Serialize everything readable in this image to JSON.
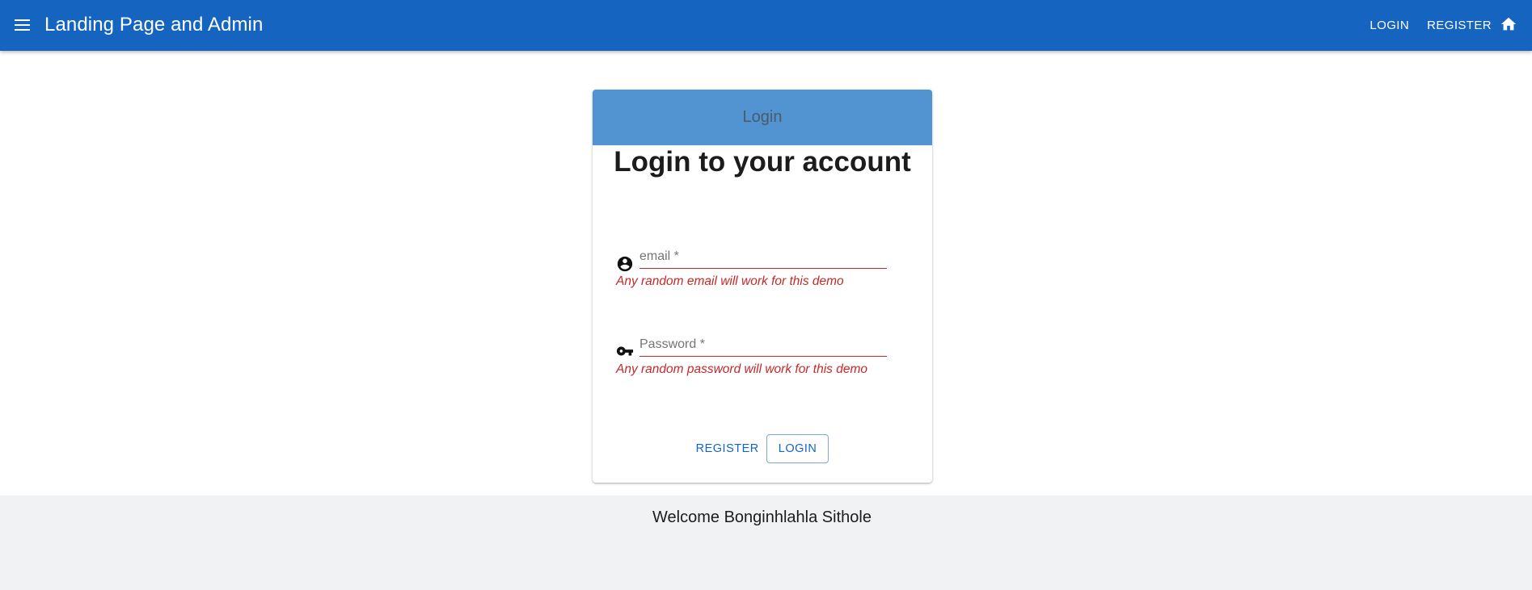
{
  "appbar": {
    "title": "Landing Page and Admin",
    "menu_icon": "menu-icon",
    "nav": {
      "login": "LOGIN",
      "register": "REGISTER",
      "home_icon": "home-icon"
    },
    "color": "#1565c0"
  },
  "card": {
    "header": "Login",
    "title": "Login to your account",
    "header_color": "#5194d1",
    "email": {
      "icon": "account-circle-icon",
      "label": "email *",
      "value": "",
      "helper": "Any random email will work for this demo"
    },
    "password": {
      "icon": "key-icon",
      "label": "Password *",
      "value": "",
      "helper": "Any random password will work for this demo"
    },
    "actions": {
      "register": "REGISTER",
      "login": "LOGIN"
    }
  },
  "footer": {
    "welcome": "Welcome Bonginhlahla Sithole"
  },
  "colors": {
    "error": "#c62828",
    "footer_bg": "#f1f2f4"
  }
}
